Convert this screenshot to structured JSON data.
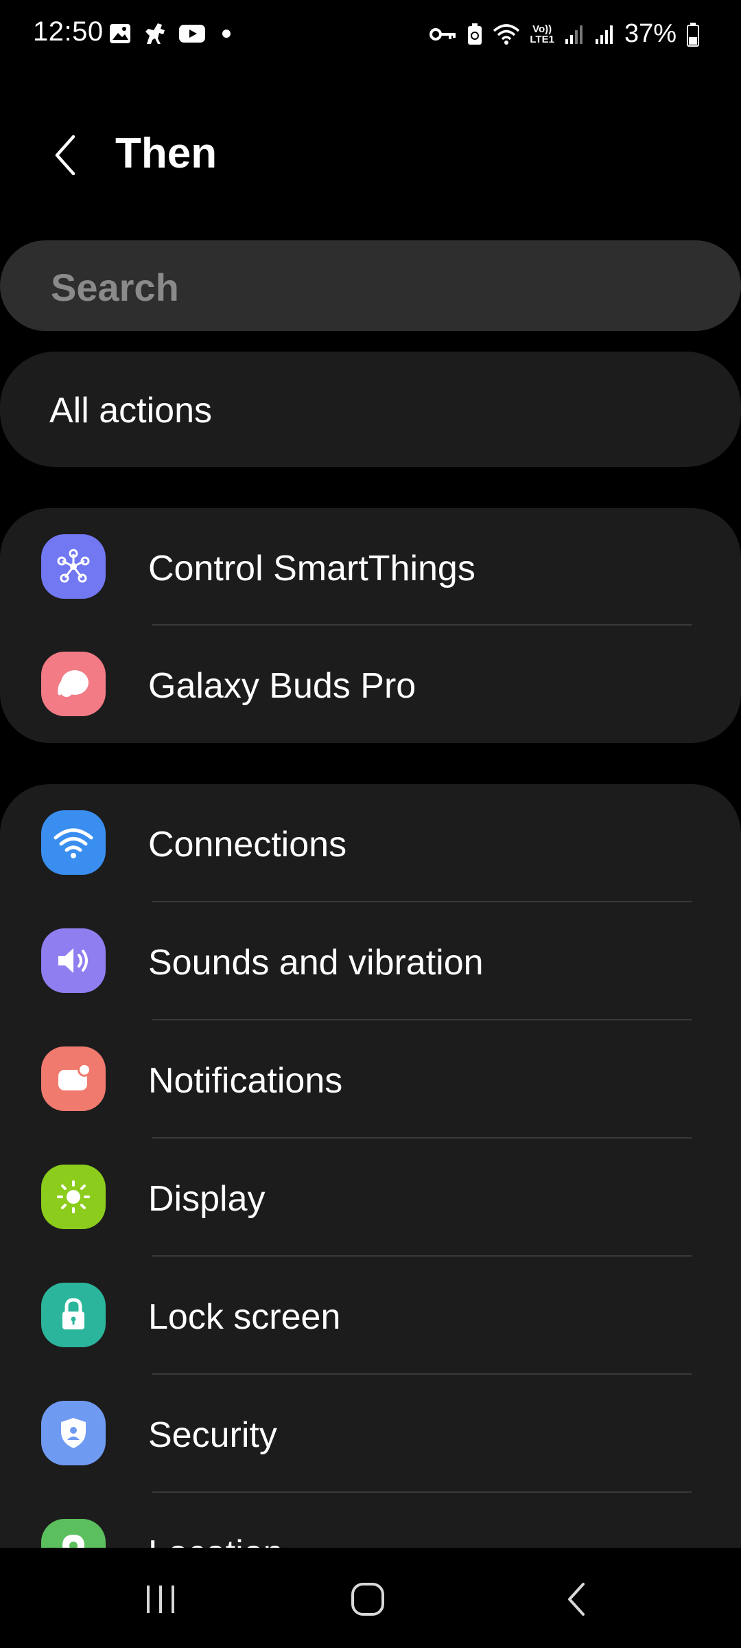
{
  "status_bar": {
    "time": "12:50",
    "battery_text": "37%",
    "left_icons": [
      "gallery-icon",
      "horse-app-icon",
      "youtube-icon",
      "notification-dot"
    ],
    "right_icons": [
      "vpn-key-icon",
      "battery-saver-icon",
      "wifi-icon",
      "volte-lte-icon",
      "signal-icon",
      "signal-icon",
      "battery-icon"
    ],
    "volte_text": "Vo))",
    "lte_text": "LTE1"
  },
  "header": {
    "title": "Then",
    "back_icon": "chevron-left-icon"
  },
  "search": {
    "placeholder": "Search",
    "value": ""
  },
  "all_actions": {
    "label": "All actions"
  },
  "devices": [
    {
      "label": "Control SmartThings",
      "icon": "smartthings-icon",
      "color": "#7277f2"
    },
    {
      "label": "Galaxy Buds Pro",
      "icon": "galaxy-buds-icon",
      "color": "#f27b86"
    }
  ],
  "settings": [
    {
      "label": "Connections",
      "icon": "wifi-icon",
      "color": "#3a8ef0"
    },
    {
      "label": "Sounds and vibration",
      "icon": "speaker-icon",
      "color": "#8f7ef0"
    },
    {
      "label": "Notifications",
      "icon": "notification-icon",
      "color": "#f07a6e"
    },
    {
      "label": "Display",
      "icon": "sun-icon",
      "color": "#8bcc1c"
    },
    {
      "label": "Lock screen",
      "icon": "lock-icon",
      "color": "#2bb59c"
    },
    {
      "label": "Security",
      "icon": "shield-icon",
      "color": "#6f9af2"
    },
    {
      "label": "Location",
      "icon": "location-icon",
      "color": "#5cbf5e"
    }
  ],
  "nav_bar": {
    "recents_icon": "recents-icon",
    "home_icon": "home-icon",
    "back_icon": "back-icon"
  }
}
